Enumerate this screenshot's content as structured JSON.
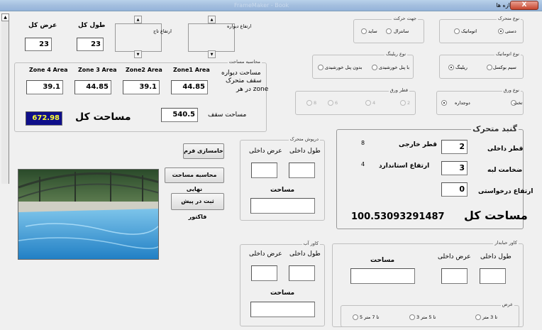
{
  "window": {
    "title": "انتخاب اندازه ها",
    "background_title": "FrameMaker - Book",
    "close_label": "X"
  },
  "top_dims": {
    "width_label": "عرض کل",
    "length_label": "طول کل",
    "width_value": "23",
    "length_value": "23",
    "crown_height_label": "ارتفاع تاج",
    "wall_height_label": "ارتفاع دیواره",
    "spin_up": "▲",
    "spin_down": "▼"
  },
  "area_calc": {
    "title": "محاسبه مساحت",
    "zones": [
      {
        "label": "Zone 4 Area",
        "value": "39.1"
      },
      {
        "label": "Zone 3 Area",
        "value": "44.85"
      },
      {
        "label": "Zone2 Area",
        "value": "39.1"
      },
      {
        "label": "Zone1 Area",
        "value": "44.85"
      }
    ],
    "description_line1": "مساحت دیواره",
    "description_line2": "سقف متحرک",
    "description_line3": "در هر zone",
    "total_area_label": "مساحت کل",
    "total_area_value": "672.98",
    "roof_area_label": "مساحت سقف",
    "roof_area_value": "540.5"
  },
  "motion_dir": {
    "title": "جهت حرکت",
    "options": [
      {
        "label": "سانترال",
        "checked": false
      },
      {
        "label": "ساید",
        "checked": false
      }
    ]
  },
  "motion_type": {
    "title": "نوع متحرک",
    "options": [
      {
        "label": "دستی",
        "checked": true
      },
      {
        "label": "اتوماتیک",
        "checked": false
      }
    ]
  },
  "rail_type": {
    "title": "نوع ریلینگ",
    "options": [
      {
        "label": "بدون پنل خورشیدی",
        "checked": false
      },
      {
        "label": "با پنل خورشیدی",
        "checked": false
      }
    ]
  },
  "auto_type": {
    "title": "نوع اتوماتیک",
    "options": [
      {
        "label": "سیم بوکسل",
        "checked": false
      },
      {
        "label": "ریلینگ",
        "checked": true
      }
    ]
  },
  "sheet_dia": {
    "title": "قطر ورق",
    "options": [
      {
        "label": "8"
      },
      {
        "label": "6"
      },
      {
        "label": "4"
      },
      {
        "label": "2"
      }
    ]
  },
  "sheet_type": {
    "title": "نوع ورق",
    "options": [
      {
        "label": "تخت",
        "checked": false
      },
      {
        "label": "دوجداره",
        "checked": true
      }
    ]
  },
  "buttons": {
    "reset": "خامسازی فرم",
    "final_calc": "محاسبه مساحت نهایی",
    "invoice": "ثبت در پیش فاکتور"
  },
  "moving_door": {
    "title": "درپوش متحرک",
    "inner_width": "عرض داخلی",
    "inner_length": "طول داخلی",
    "area_label": "مساحت"
  },
  "water_cover": {
    "title": "کاور آب",
    "inner_width": "عرض داخلی",
    "inner_length": "طول داخلی",
    "area_label": "مساحت"
  },
  "dome": {
    "title": "گنبد متحرک",
    "outer_dia_label": "قطر خارجی",
    "outer_dia_value": "8",
    "standard_height_label": "ارتفاع استاندارد",
    "standard_height_value": "4",
    "inner_dia_label": "قطر داخلی",
    "inner_dia_value": "2",
    "wall_thickness_label": "ضخامت لبه",
    "wall_thickness_value": "3",
    "requested_height_label": "ارتفاع درخواستی",
    "requested_height_value": "0",
    "total_area_label": "مساحت کل",
    "total_area_value": "100.53093291487"
  },
  "fixed_cover": {
    "title": "کاور حبابدار",
    "inner_length": "طول داخلی",
    "inner_width": "عرض داخلی",
    "area_label": "مساحت",
    "width_group_title": "عرض",
    "width_options": [
      {
        "label": "تا 3 متر"
      },
      {
        "label": "3 تا 5 متر"
      },
      {
        "label": "5 تا 7 متر"
      }
    ]
  },
  "colors": {
    "total_area_bg": "#0f0f8a",
    "total_area_fg": "#ffff33",
    "titlebar": "#a4bfdf",
    "close_button": "#c7472f"
  }
}
